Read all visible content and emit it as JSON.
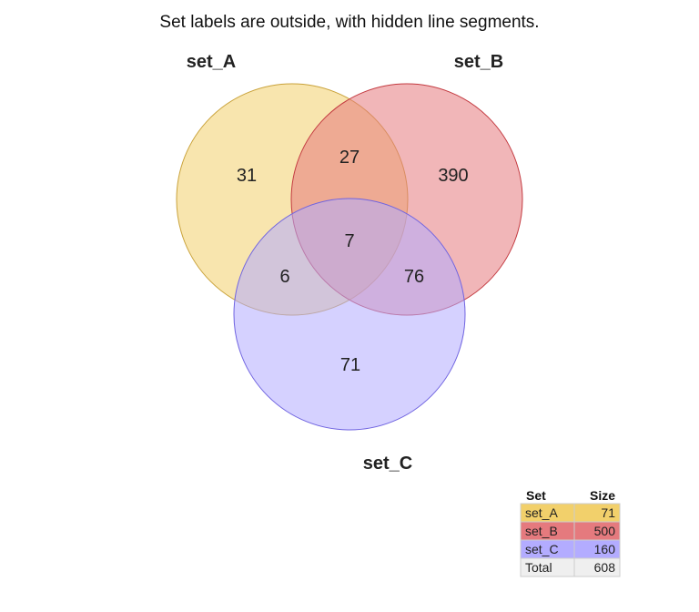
{
  "chart_data": {
    "type": "venn",
    "title": "Set labels are outside, with hidden line segments.",
    "sets": [
      {
        "name": "set_A",
        "size": 71,
        "fill": "#f2d06b",
        "stroke": "#c9a23a"
      },
      {
        "name": "set_B",
        "size": 500,
        "fill": "#e57a7e",
        "stroke": "#c33a40"
      },
      {
        "name": "set_C",
        "size": 160,
        "fill": "#b3acff",
        "stroke": "#6f63e0"
      }
    ],
    "regions": [
      {
        "sets": [
          "set_A"
        ],
        "value": 31
      },
      {
        "sets": [
          "set_B"
        ],
        "value": 390
      },
      {
        "sets": [
          "set_C"
        ],
        "value": 71
      },
      {
        "sets": [
          "set_A",
          "set_B"
        ],
        "value": 27
      },
      {
        "sets": [
          "set_A",
          "set_C"
        ],
        "value": 6
      },
      {
        "sets": [
          "set_B",
          "set_C"
        ],
        "value": 76
      },
      {
        "sets": [
          "set_A",
          "set_B",
          "set_C"
        ],
        "value": 7
      }
    ],
    "legend": {
      "position": "bottom-right",
      "headers": [
        "Set",
        "Size"
      ],
      "rows": [
        {
          "set": "set_A",
          "size": 71,
          "color": "#f2d06b"
        },
        {
          "set": "set_B",
          "size": 500,
          "color": "#e57a7e"
        },
        {
          "set": "set_C",
          "size": 160,
          "color": "#b3acff"
        },
        {
          "set": "Total",
          "size": 608,
          "color": "#efefef"
        }
      ]
    }
  }
}
